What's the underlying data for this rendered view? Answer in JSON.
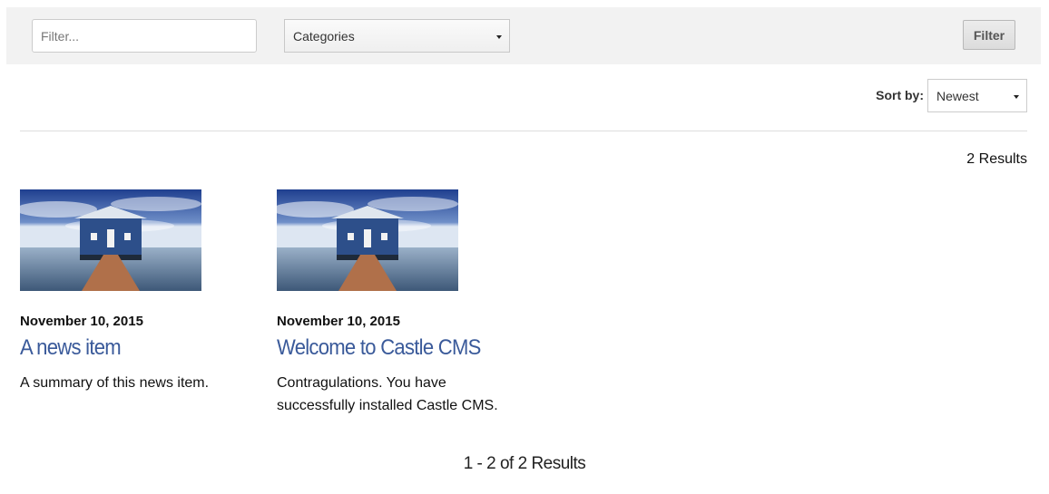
{
  "filter_bar": {
    "filter_placeholder": "Filter...",
    "categories_label": "Categories",
    "filter_button": "Filter"
  },
  "sort": {
    "label": "Sort by:",
    "selected": "Newest"
  },
  "results_count": "2 Results",
  "items": [
    {
      "date": "November 10, 2015",
      "title": "A news item",
      "summary": "A summary of this news item.",
      "image": "boathouse-photo"
    },
    {
      "date": "November 10, 2015",
      "title": "Welcome to Castle CMS",
      "summary": "Contragulations. You have successfully installed Castle CMS.",
      "image": "boathouse-photo"
    }
  ],
  "pagination": "1 - 2 of 2 Results",
  "colors": {
    "link": "#3a5a9a",
    "filter_bar_bg": "#f2f2f2"
  }
}
